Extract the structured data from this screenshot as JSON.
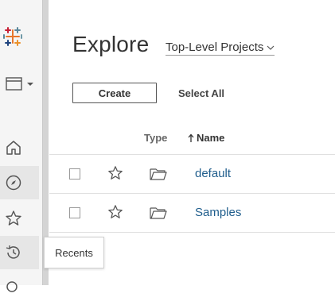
{
  "page": {
    "title": "Explore",
    "project_filter": "Top-Level Projects"
  },
  "toolbar": {
    "create_label": "Create",
    "select_all_label": "Select All"
  },
  "table": {
    "columns": [
      {
        "label": "Type"
      },
      {
        "label": "Name",
        "sort": "ascending"
      }
    ],
    "rows": [
      {
        "name": "default",
        "type_icon": "folder-icon"
      },
      {
        "name": "Samples",
        "type_icon": "folder-icon"
      }
    ]
  },
  "sidebar": {
    "items": [
      {
        "icon": "home-icon"
      },
      {
        "icon": "explore-compass-icon",
        "active": true
      },
      {
        "icon": "favorites-star-icon"
      },
      {
        "icon": "recents-clock-icon"
      }
    ],
    "tooltip": "Recents"
  },
  "colors": {
    "link": "#1f5d8c",
    "sidebar_bg": "#f5f5f5",
    "active_bg": "#e6e6e6"
  }
}
